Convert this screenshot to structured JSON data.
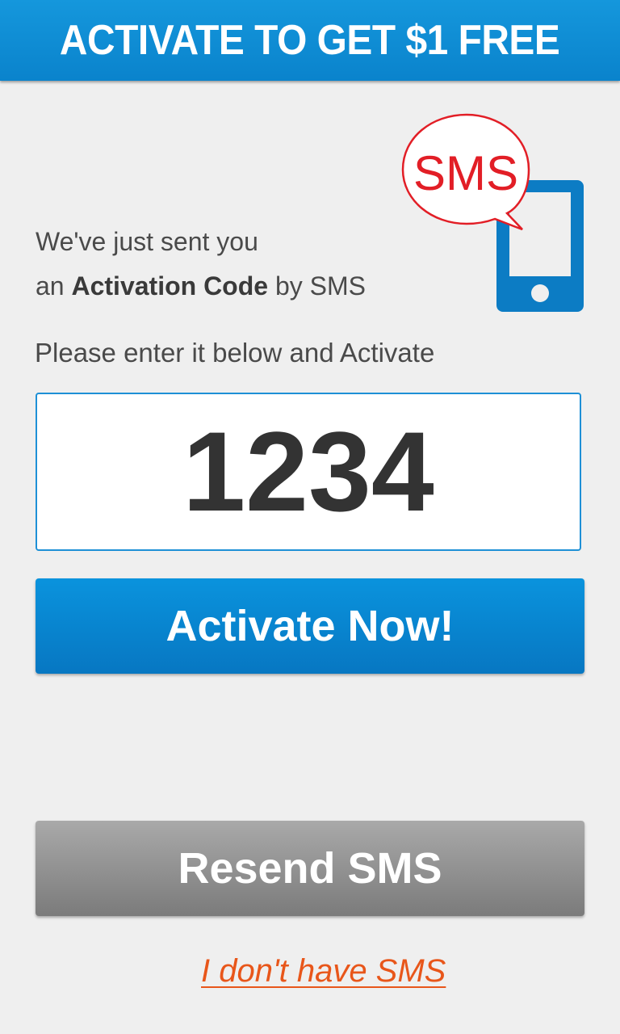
{
  "header": {
    "title": "ACTIVATE TO GET $1 FREE",
    "color": "#0a8fd6"
  },
  "illustration": {
    "bubble_text": "SMS",
    "bubble_color": "#e21e26",
    "phone_color": "#0c7cc4",
    "icon": "sms-phone-icon"
  },
  "intro": {
    "line1": "We've just sent you",
    "line2_prefix": "an ",
    "line2_bold": "Activation Code",
    "line2_suffix": " by SMS"
  },
  "instruction": "Please enter it below and Activate",
  "code_input": {
    "value": "1234"
  },
  "buttons": {
    "activate_label": "Activate Now!",
    "resend_label": "Resend SMS"
  },
  "link": {
    "no_sms_label": "I don't have SMS",
    "color": "#e8561a"
  }
}
